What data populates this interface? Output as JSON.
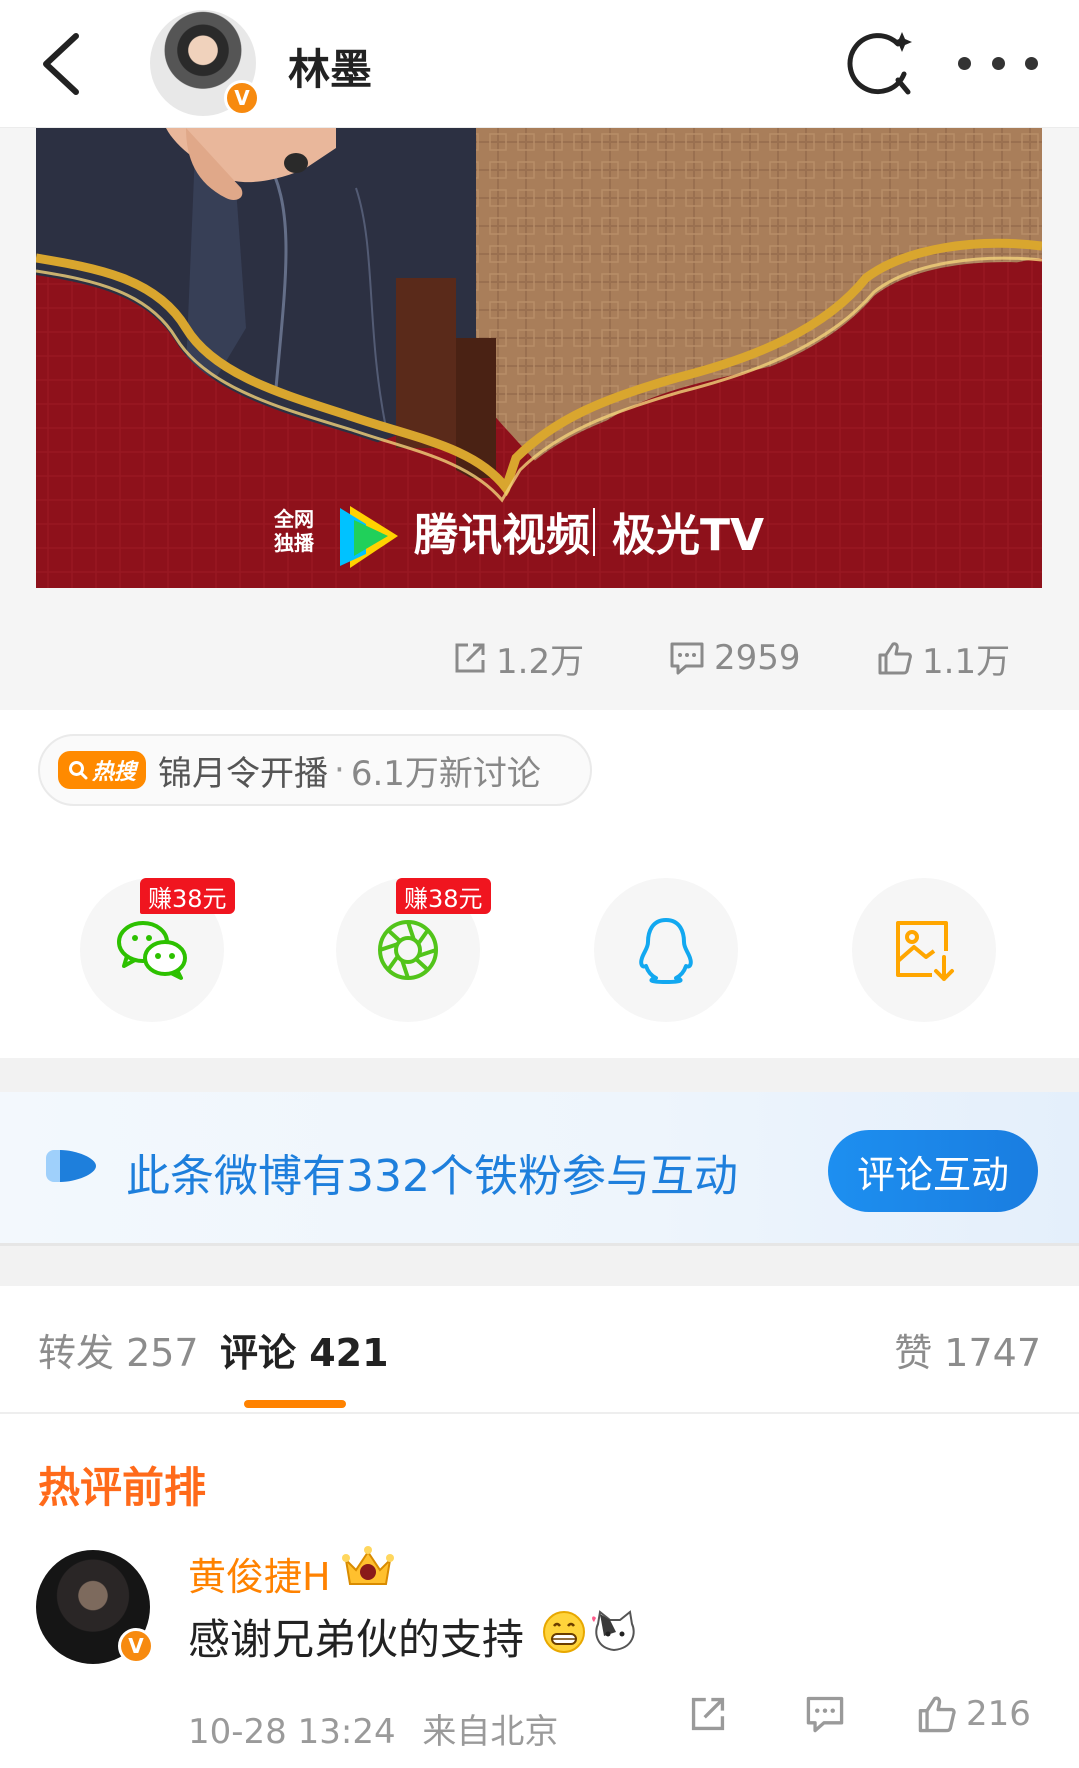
{
  "header": {
    "username": "林墨",
    "verified_badge": "V",
    "icons": [
      "chevron-left-icon",
      "super-topic-icon",
      "more-dots-icon"
    ]
  },
  "banner": {
    "exclusive_line1": "全网",
    "exclusive_line2": "独播",
    "platform": "腾讯视频",
    "partner": "极光TV",
    "colors": {
      "red": "#8e111b",
      "gold": "#d9a62e",
      "tan": "#b08560"
    }
  },
  "stats": {
    "reposts": "1.2万",
    "comments": "2959",
    "likes": "1.1万"
  },
  "hot_search": {
    "tag": "热搜",
    "topic": "锦月令开播",
    "separator": "·",
    "count": "6.1万新讨论"
  },
  "share": {
    "wechat_earn": "赚38元",
    "moments_earn": "赚38元",
    "icons": [
      "wechat-icon",
      "moments-icon",
      "qq-icon",
      "save-image-icon"
    ]
  },
  "fans_banner": {
    "text": "此条微博有332个铁粉参与互动",
    "button": "评论互动"
  },
  "tabs": {
    "repost": "转发 257",
    "comment": "评论 421",
    "like": "赞 1747"
  },
  "comments": {
    "section_title": "热评前排",
    "items": [
      {
        "user": "黄俊捷H",
        "text": "感谢兄弟伙的支持",
        "time": "10-28 13:24",
        "location": "来自北京",
        "likes": "216"
      }
    ]
  },
  "accent_colors": {
    "orange": "#ff8200",
    "blue": "#1e7fdc",
    "red_tag": "#f0151f"
  }
}
